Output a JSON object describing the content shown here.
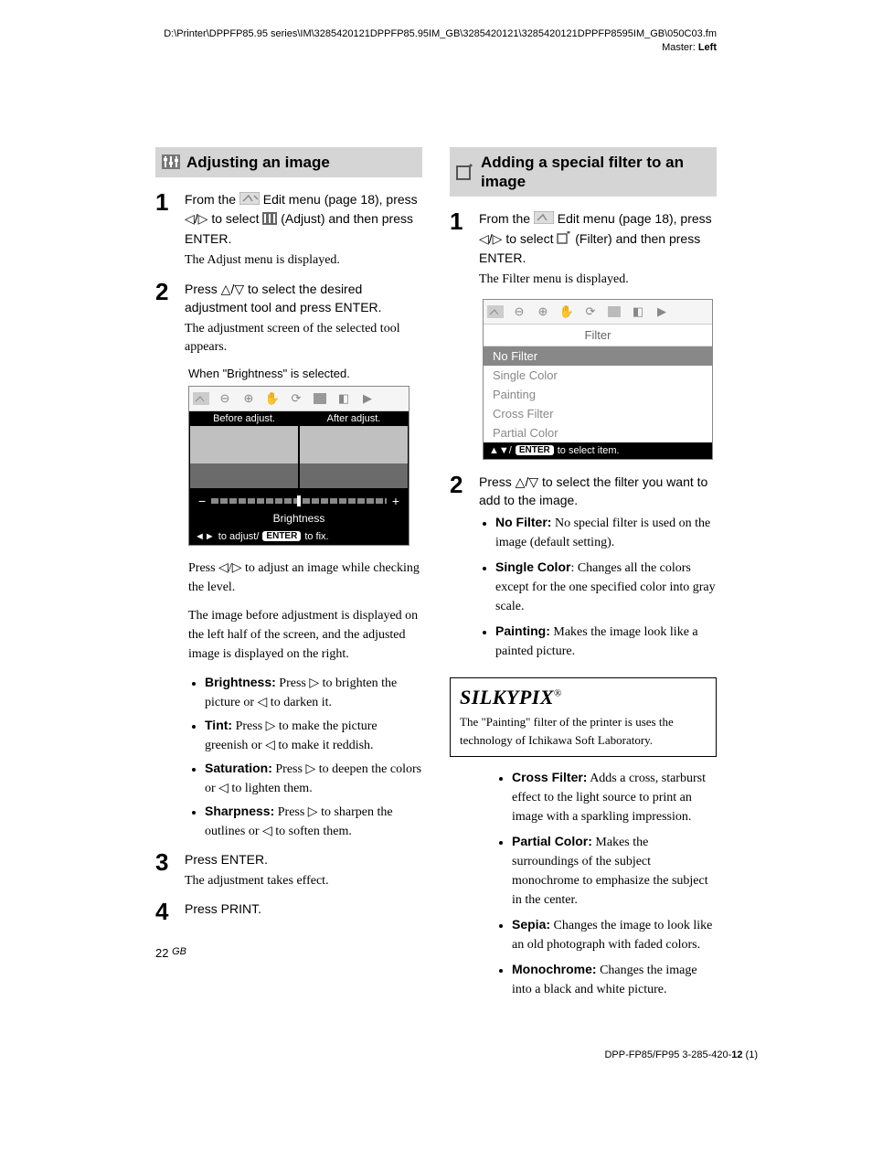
{
  "header": {
    "path": "D:\\Printer\\DPPFP85.95 series\\IM\\3285420121DPPFP85.95IM_GB\\3285420121\\3285420121DPPFP8595IM_GB\\050C03.fm",
    "master_label": "Master: ",
    "master_value": "Left"
  },
  "left": {
    "section_title": "Adjusting an image",
    "step1": {
      "a": "From the ",
      "b": " Edit menu (page 18), press ",
      "c": " to select ",
      "d": " (Adjust) and then press ENTER.",
      "sub": "The Adjust menu is displayed."
    },
    "step2": {
      "main": "Press △/▽ to select the desired adjustment tool and press ENTER.",
      "sub": "The adjustment screen of the selected tool appears."
    },
    "bright_caption": "When \"Brightness\" is selected.",
    "bright": {
      "before": "Before adjust.",
      "after": "After adjust.",
      "label": "Brightness",
      "footer_a": "◄►",
      "footer_b": "to adjust/",
      "enter": "ENTER",
      "footer_c": "to fix."
    },
    "after1": "Press ◁/▷ to adjust an image while checking the level.",
    "after2": "The image before adjustment is displayed on the left half of the screen, and the adjusted image is displayed on the right.",
    "bullets": [
      {
        "label": "Brightness:",
        "text": " Press ▷ to brighten the picture or ◁ to darken it."
      },
      {
        "label": "Tint:",
        "text": " Press ▷ to make the picture greenish or ◁ to make it reddish."
      },
      {
        "label": "Saturation:",
        "text": " Press ▷ to deepen the colors or ◁ to lighten them."
      },
      {
        "label": "Sharpness:",
        "text": " Press ▷ to sharpen the outlines or ◁ to soften them."
      }
    ],
    "step3": {
      "main": "Press ENTER.",
      "sub": "The adjustment takes effect."
    },
    "step4": {
      "main": "Press PRINT."
    }
  },
  "right": {
    "section_title": "Adding a special filter to an image",
    "step1": {
      "a": "From the ",
      "b": " Edit menu (page 18), press ",
      "c": " to select ",
      "d": " (Filter) and then press ENTER.",
      "sub": "The Filter menu is displayed."
    },
    "filter_panel": {
      "title": "Filter",
      "items": [
        "No Filter",
        "Single Color",
        "Painting",
        "Cross Filter",
        "Partial Color"
      ],
      "footer_a": "▲▼/",
      "enter": "ENTER",
      "footer_b": "to select item."
    },
    "step2": {
      "main": "Press △/▽ to select the filter you want to add to the image."
    },
    "bullets1": [
      {
        "label": "No Filter:",
        "text": " No special filter is used on the image (default setting)."
      },
      {
        "label": "Single Color",
        "suffix": ":",
        "text": " Changes all the colors except for the one specified color into gray scale."
      },
      {
        "label": "Painting:",
        "text": " Makes the image look like a painted picture."
      }
    ],
    "silkypix": {
      "title": "SILKYPIX",
      "reg": "®",
      "body": "The \"Painting\" filter of the printer is uses the technology of Ichikawa Soft Laboratory."
    },
    "bullets2": [
      {
        "label": "Cross Filter:",
        "text": " Adds a cross, starburst effect to the light source to print an image with a sparkling impression."
      },
      {
        "label": "Partial Color:",
        "text": " Makes the surroundings of the subject monochrome to emphasize the subject in the center."
      },
      {
        "label": "Sepia:",
        "text": " Changes the image to look like an old photograph with faded colors."
      },
      {
        "label": "Monochrome:",
        "text": " Changes the image into a black and white picture."
      }
    ]
  },
  "page_number": "22",
  "page_gb": "GB",
  "footer": {
    "a": "DPP-FP85/FP95 3-285-420-",
    "b": "12",
    "c": " (1)"
  }
}
